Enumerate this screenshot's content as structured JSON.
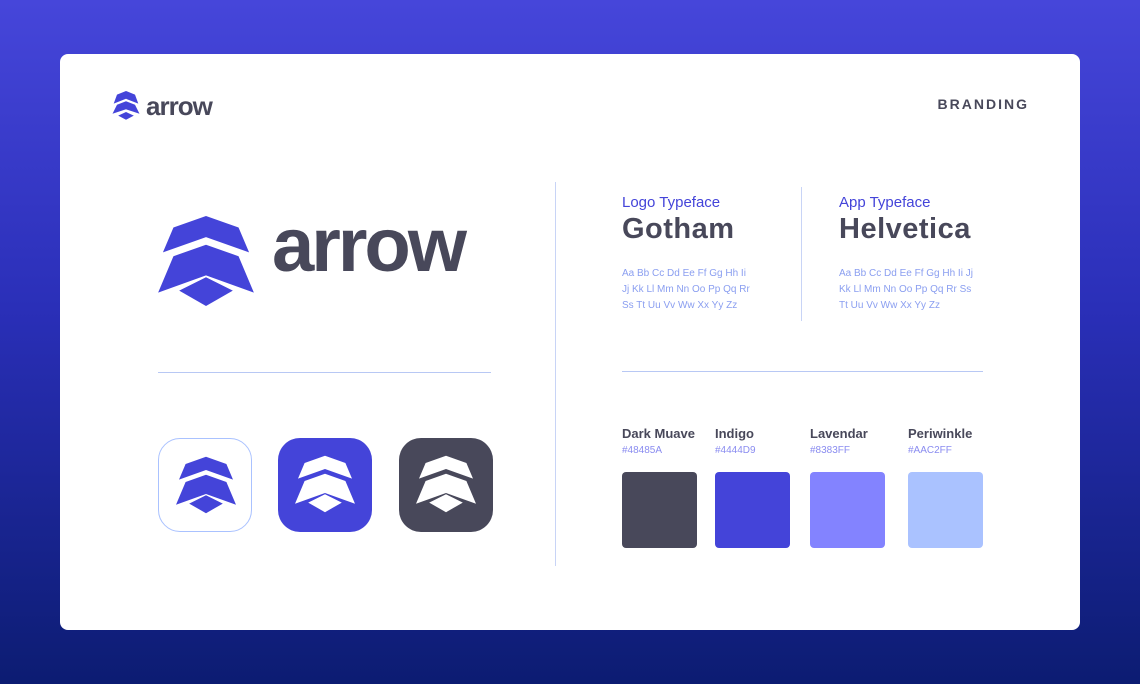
{
  "header": {
    "logo_text": "arrow",
    "section_label": "BRANDING"
  },
  "logo": {
    "wordmark": "arrow"
  },
  "typefaces": [
    {
      "label": "Logo Typeface",
      "name": "Gotham",
      "sample": [
        "Aa Bb Cc Dd Ee Ff Gg Hh Ii",
        "Jj Kk Ll Mm Nn Oo Pp Qq Rr",
        "Ss Tt Uu Vv Ww Xx Yy Zz"
      ]
    },
    {
      "label": "App Typeface",
      "name": "Helvetica",
      "sample": [
        "Aa Bb Cc Dd Ee Ff Gg Hh Ii Jj",
        "Kk Ll Mm Nn Oo Pp Qq Rr Ss",
        "Tt Uu Vv Ww Xx Yy Zz"
      ]
    }
  ],
  "palette": [
    {
      "name": "Dark Muave",
      "hex": "#48485A",
      "color": "#48485A"
    },
    {
      "name": "Indigo",
      "hex": "#4444D9",
      "color": "#4444D9"
    },
    {
      "name": "Lavendar",
      "hex": "#8383FF",
      "color": "#8383FF"
    },
    {
      "name": "Periwinkle",
      "hex": "#AAC2FF",
      "color": "#AAC2FF"
    }
  ],
  "app_icons": [
    "arrow-icon-light",
    "arrow-icon-indigo",
    "arrow-icon-dark"
  ],
  "colors": {
    "background_top": "#4646DA",
    "background_bottom": "#0C1C72",
    "brand": "#4444D9",
    "text": "#48485A"
  }
}
